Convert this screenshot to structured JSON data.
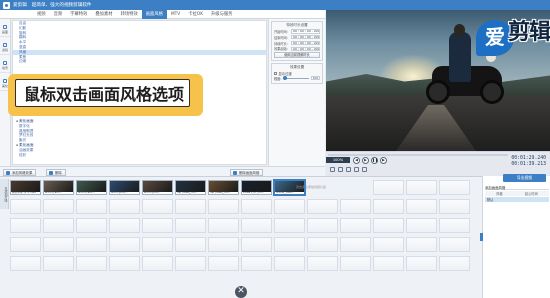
{
  "window": {
    "app_name": "爱剪辑",
    "menu_left": "超简单、强大的视频剪辑软件",
    "menu_right": "强大的视频剪辑软件"
  },
  "tabs": [
    "视频",
    "音频",
    "字幕特效",
    "叠加素材",
    "转场特效",
    "画面风格",
    "MTV",
    "卡拉OK",
    "升级与服务"
  ],
  "active_tab": "画面风格",
  "side_tools": [
    {
      "label": "画面",
      "icon": "picture-icon"
    },
    {
      "label": "滤镜",
      "icon": "filter-icon"
    },
    {
      "label": "动景",
      "icon": "motion-icon"
    },
    {
      "label": "美化",
      "icon": "beautify-icon"
    }
  ],
  "style_list": {
    "items_top": [
      {
        "text": "自由",
        "kind": "item"
      },
      {
        "text": "幻影",
        "kind": "item"
      },
      {
        "text": "旋转",
        "kind": "item"
      },
      {
        "text": "翻转",
        "kind": "item"
      },
      {
        "text": "水平",
        "kind": "item"
      },
      {
        "text": "竖直",
        "kind": "item"
      },
      {
        "text": "风格",
        "kind": "item"
      },
      {
        "text": "柔焦",
        "kind": "item"
      },
      {
        "text": "边缘",
        "kind": "item"
      }
    ],
    "items_bottom": [
      {
        "text": "美化画面",
        "kind": "cat"
      },
      {
        "text": "数字化",
        "kind": "item"
      },
      {
        "text": "晶莹剔透",
        "kind": "item"
      },
      {
        "text": "梦幻光效",
        "kind": "item"
      },
      {
        "text": "聚光",
        "kind": "item"
      },
      {
        "text": "柔化画面",
        "kind": "cat"
      },
      {
        "text": "油画效果",
        "kind": "item"
      },
      {
        "text": "炫彩",
        "kind": "item"
      }
    ],
    "selected": "风格"
  },
  "callout": {
    "text": "鼠标双击画面风格选项"
  },
  "properties": {
    "group1_title": "特效时长设置",
    "fields": [
      {
        "label": "开始时间:",
        "value": "00 : 00 : 00 . 000"
      },
      {
        "label": "结束时间:",
        "value": "00 : 00 : 00 . 000"
      },
      {
        "label": "持续时长:",
        "value": "00 : 00 : 00 . 000"
      },
      {
        "label": "效果起始:",
        "value": "00 : 00 : 00 . 000"
      }
    ],
    "button_current": "使用当前视频时长",
    "group2_title": "效果设置",
    "checkbox_label": "显示过渡",
    "degree_label": "程度:",
    "degree_value": "100",
    "degree_fraction": 0.0
  },
  "confirm_button": "确认修改",
  "action_bar": {
    "add_style": "添加风格效果",
    "delete": "删除",
    "remove_style": "删除画面风格"
  },
  "player": {
    "zoom": "100%",
    "time_current": "00:01:29.240",
    "time_total": "00:01:39.213"
  },
  "brand": {
    "first": "爱",
    "rest": "剪辑"
  },
  "right_panel": {
    "export_button": "导出视频",
    "header": "添加画面风格",
    "col1": "风格",
    "col2": "起止时间",
    "row1": "默认"
  },
  "timeline": {
    "track_label": "已添加片段",
    "clips": [
      {
        "name": "城市印象 (27).mp4",
        "color": "#4a3a2c"
      },
      {
        "name": "archi (ranc…",
        "color": "#6c5d4e"
      },
      {
        "name": "archi (ranc…",
        "color": "#3e5a4d"
      },
      {
        "name": "archi (prs)…",
        "color": "#2f4b6e"
      },
      {
        "name": "archi (prs)…",
        "color": "#5b4a3f"
      },
      {
        "name": "dlp (luxe)_rot…",
        "color": "#21323f"
      },
      {
        "name": "dlp (luxe)_rot…",
        "color": "#6a4e2f"
      },
      {
        "name": "EOB25_27_23…",
        "color": "#17202a"
      },
      {
        "name": "MVI02_mov…",
        "color": "#3b6a8c"
      }
    ],
    "selected_clip": 8,
    "drop_hint": "双击此处添加视频片段"
  }
}
